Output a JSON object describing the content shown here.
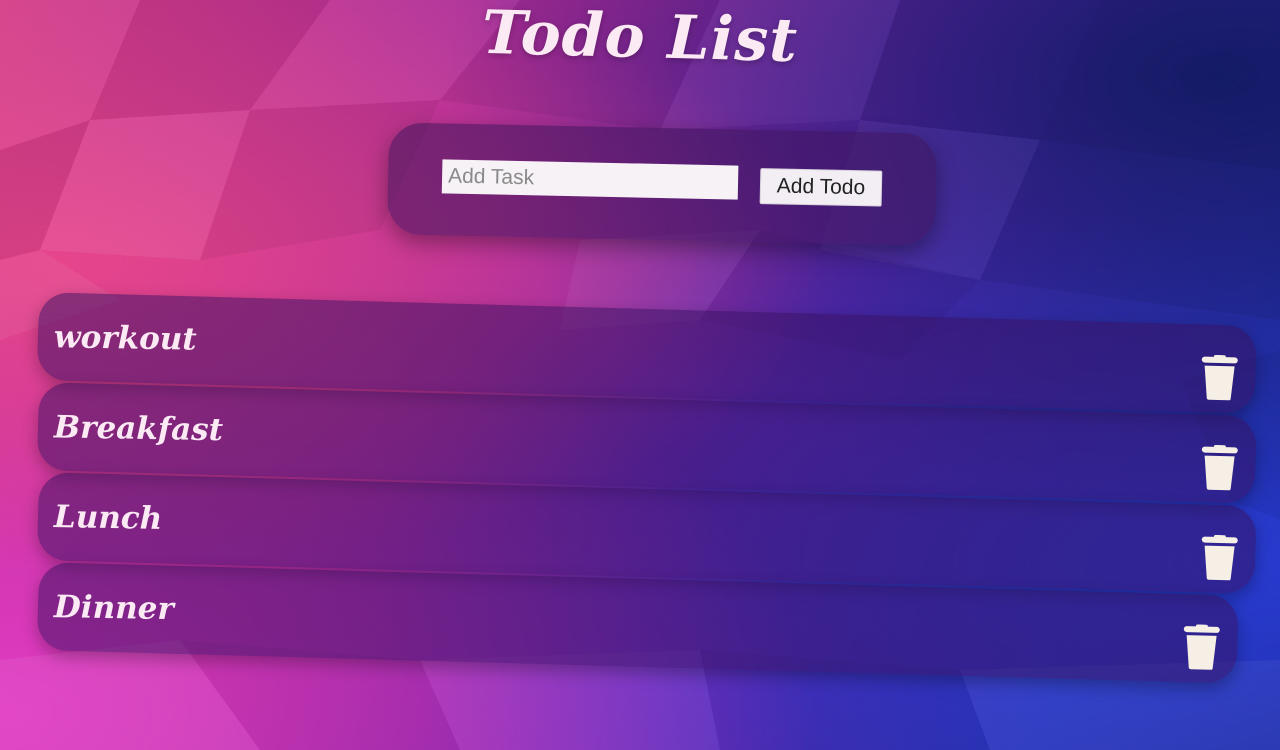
{
  "header": {
    "title": "Todo List"
  },
  "add_form": {
    "input_placeholder": "Add Task",
    "input_value": "",
    "button_label": "Add Todo"
  },
  "todos": [
    {
      "text": "workout",
      "delete_icon": "trash-icon"
    },
    {
      "text": "Breakfast",
      "delete_icon": "trash-icon"
    },
    {
      "text": "Lunch",
      "delete_icon": "trash-icon"
    },
    {
      "text": "Dinner",
      "delete_icon": "trash-icon"
    }
  ],
  "colors": {
    "text": "#fbe9f4",
    "row_background": "#37125f",
    "background_left": "#d13a86",
    "background_right": "#1a2490"
  }
}
